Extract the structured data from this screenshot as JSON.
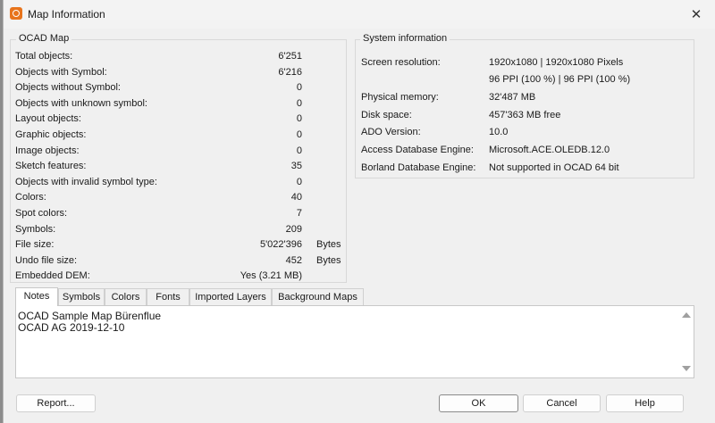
{
  "window": {
    "title": "Map Information",
    "close_glyph": "✕"
  },
  "ocad_map": {
    "title": "OCAD Map",
    "rows": [
      {
        "label": "Total objects:",
        "value": "6'251",
        "unit": ""
      },
      {
        "label": "Objects with Symbol:",
        "value": "6'216",
        "unit": ""
      },
      {
        "label": "Objects without Symbol:",
        "value": "0",
        "unit": ""
      },
      {
        "label": "Objects with unknown symbol:",
        "value": "0",
        "unit": ""
      },
      {
        "label": "Layout objects:",
        "value": "0",
        "unit": ""
      },
      {
        "label": "Graphic objects:",
        "value": "0",
        "unit": ""
      },
      {
        "label": "Image objects:",
        "value": "0",
        "unit": ""
      },
      {
        "label": "Sketch features:",
        "value": "35",
        "unit": ""
      },
      {
        "label": "Objects with invalid symbol type:",
        "value": "0",
        "unit": ""
      },
      {
        "label": "Colors:",
        "value": "40",
        "unit": ""
      },
      {
        "label": "Spot colors:",
        "value": "7",
        "unit": ""
      },
      {
        "label": "Symbols:",
        "value": "209",
        "unit": ""
      },
      {
        "label": "File size:",
        "value": "5'022'396",
        "unit": "Bytes"
      },
      {
        "label": "Undo file size:",
        "value": "452",
        "unit": "Bytes"
      },
      {
        "label": "Embedded DEM:",
        "value": "Yes (3.21 MB)",
        "unit": ""
      }
    ]
  },
  "system_info": {
    "title": "System information",
    "rows": [
      {
        "label": "Screen resolution:",
        "value": "1920x1080 | 1920x1080 Pixels"
      },
      {
        "label": "",
        "value": "96 PPI (100 %) | 96 PPI (100 %)"
      },
      {
        "label": "Physical memory:",
        "value": "32'487 MB"
      },
      {
        "label": "Disk space:",
        "value": "457'363 MB free"
      },
      {
        "label": "ADO Version:",
        "value": "10.0"
      },
      {
        "label": "Access Database Engine:",
        "value": "Microsoft.ACE.OLEDB.12.0"
      },
      {
        "label": "Borland Database Engine:",
        "value": "Not supported in OCAD 64 bit"
      }
    ]
  },
  "tabs": [
    "Notes",
    "Symbols",
    "Colors",
    "Fonts",
    "Imported Layers",
    "Background Maps"
  ],
  "active_tab": "Notes",
  "notes": {
    "lines": [
      "OCAD Sample Map Bürenflue",
      "OCAD AG 2019-12-10"
    ]
  },
  "buttons": {
    "report": "Report...",
    "ok": "OK",
    "cancel": "Cancel",
    "help": "Help"
  },
  "colors": {
    "app_icon": "#e8741c",
    "background": "#f0f0f0"
  }
}
